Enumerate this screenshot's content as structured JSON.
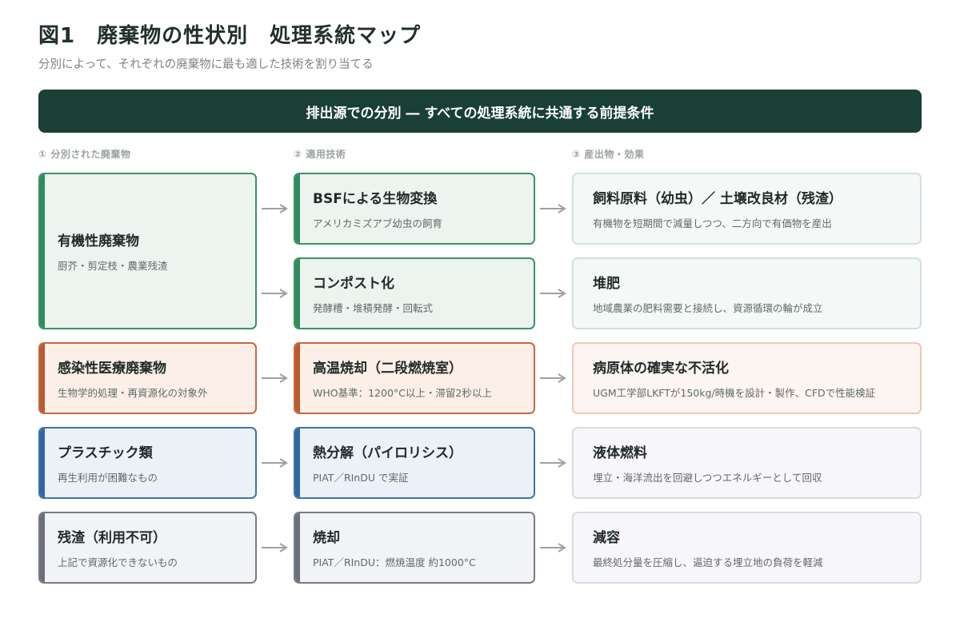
{
  "title": "図1　廃棄物の性状別　処理系統マップ",
  "subtitle": "分別によって、それぞれの廃棄物に最も適した技術を割り当てる",
  "banner": "排出源での分別 ― すべての処理系統に共通する前提条件",
  "columns": {
    "col1": "① 分別された廃棄物",
    "col2": "② 適用技術",
    "col3": "③ 産出物・効果"
  },
  "wastes": [
    {
      "title": "有機性廃棄物",
      "desc": "厨芥・剪定枝・農業残渣"
    },
    {
      "title": "感染性医療廃棄物",
      "desc": "生物学的処理・再資源化の対象外"
    },
    {
      "title": "プラスチック類",
      "desc": "再生利用が困難なもの"
    },
    {
      "title": "残渣（利用不可）",
      "desc": "上記で資源化できないもの"
    }
  ],
  "techs": [
    {
      "title": "BSFによる生物変換",
      "desc": "アメリカミズアブ幼虫の飼育"
    },
    {
      "title": "コンポスト化",
      "desc": "発酵槽・堆積発酵・回転式"
    },
    {
      "title": "高温焼却（二段燃焼室）",
      "desc": "WHO基準：1200°C以上・滞留2秒以上"
    },
    {
      "title": "熱分解（パイロリシス）",
      "desc": "PIAT／RInDU で実証"
    },
    {
      "title": "焼却",
      "desc": "PIAT／RInDU：燃焼温度 約1000°C"
    }
  ],
  "outputs": [
    {
      "title": "飼料原料（幼虫）／ 土壌改良材（残渣）",
      "desc": "有機物を短期間で減量しつつ、二方向で有価物を産出"
    },
    {
      "title": "堆肥",
      "desc": "地域農業の肥料需要と接続し、資源循環の輪が成立"
    },
    {
      "title": "病原体の確実な不活化",
      "desc": "UGM工学部LKFTが150kg/時機を設計・製作、CFDで性能検証"
    },
    {
      "title": "液体燃料",
      "desc": "埋立・海洋流出を回避しつつエネルギーとして回収"
    },
    {
      "title": "減容",
      "desc": "最終処分量を圧縮し、逼迫する埋立地の負荷を軽減"
    }
  ],
  "colors": {
    "organic": "#2f8a5c",
    "medical": "#b95a2f",
    "plastic": "#2f68a0",
    "residue": "#6a7079",
    "banner": "#1a3f37"
  }
}
